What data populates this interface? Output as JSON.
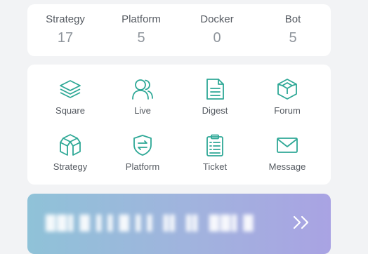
{
  "stats": [
    {
      "label": "Strategy",
      "value": "17"
    },
    {
      "label": "Platform",
      "value": "5"
    },
    {
      "label": "Docker",
      "value": "0"
    },
    {
      "label": "Bot",
      "value": "5"
    }
  ],
  "features": [
    {
      "label": "Square",
      "icon": "layers-icon"
    },
    {
      "label": "Live",
      "icon": "users-icon"
    },
    {
      "label": "Digest",
      "icon": "document-icon"
    },
    {
      "label": "Forum",
      "icon": "cube-icon"
    },
    {
      "label": "Strategy",
      "icon": "box-icon"
    },
    {
      "label": "Platform",
      "icon": "shield-exchange-icon"
    },
    {
      "label": "Ticket",
      "icon": "clipboard-icon"
    },
    {
      "label": "Message",
      "icon": "envelope-icon"
    }
  ],
  "banner": {
    "text": "██▌█ ▌▌█ ▌▌▐▌▐▌ ██▌█",
    "arrow_icon": "double-chevron-right-icon"
  },
  "colors": {
    "icon_teal": "#2ea896",
    "label_dark": "#555a61",
    "value_grey": "#8e949b"
  }
}
